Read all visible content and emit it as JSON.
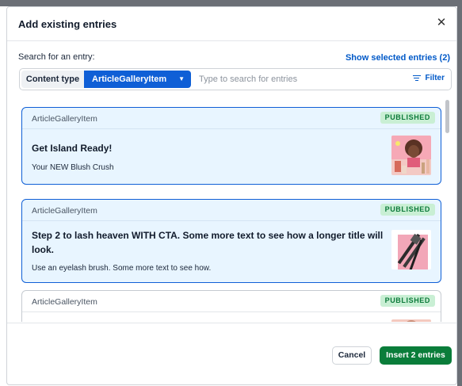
{
  "modal": {
    "title": "Add existing entries",
    "close_glyph": "✕"
  },
  "search": {
    "label": "Search for an entry:",
    "show_selected": "Show selected entries (2)",
    "content_type_label": "Content type",
    "content_type_value": "ArticleGalleryItem",
    "placeholder": "Type to search for entries",
    "filter_label": "Filter"
  },
  "entries": [
    {
      "type": "ArticleGalleryItem",
      "status": "PUBLISHED",
      "title": "Get Island Ready!",
      "description": "Your NEW Blush Crush",
      "selected": true
    },
    {
      "type": "ArticleGalleryItem",
      "status": "PUBLISHED",
      "title": "Step 2 to lash heaven WITH CTA. Some more text to see how a longer title will look.",
      "description": "Use an eyelash brush. Some more text to see how.",
      "selected": true
    },
    {
      "type": "ArticleGalleryItem",
      "status": "PUBLISHED",
      "selected": false
    }
  ],
  "footer": {
    "cancel_label": "Cancel",
    "insert_label": "Insert 2 entries"
  },
  "colors": {
    "accent": "#0f5fd6",
    "selected_bg": "#e8f5ff",
    "published_bg": "#c9efd4",
    "published_text": "#0c7a3a",
    "insert_button": "#0a7d3a"
  }
}
